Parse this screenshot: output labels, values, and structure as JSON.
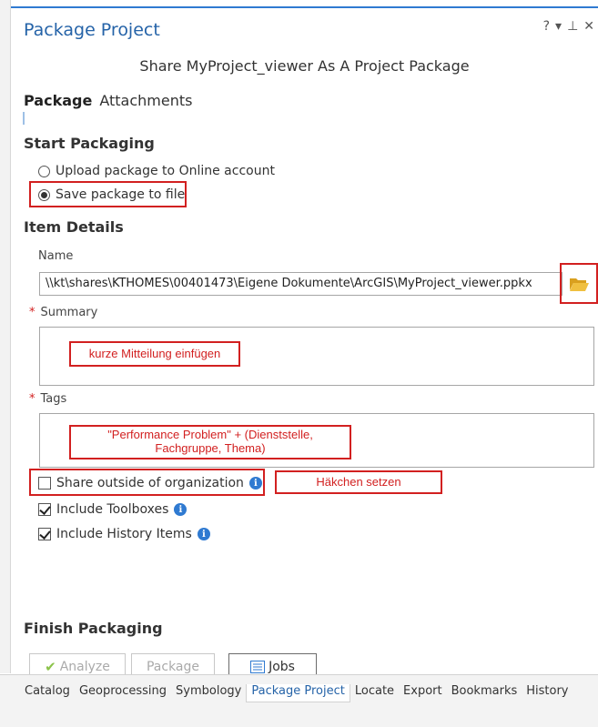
{
  "window": {
    "title": "Package Project",
    "controls": [
      "?",
      "▾",
      "⊥",
      "✕"
    ]
  },
  "subtitle": "Share MyProject_viewer As A Project Package",
  "tabs": [
    {
      "label": "Package",
      "active": true
    },
    {
      "label": "Attachments",
      "active": false
    }
  ],
  "start_packaging": {
    "heading": "Start Packaging",
    "options": [
      {
        "label": "Upload package to Online account",
        "selected": false
      },
      {
        "label": "Save package to file",
        "selected": true
      }
    ]
  },
  "item_details": {
    "heading": "Item Details",
    "name_label": "Name",
    "name_value": "\\\\kt\\shares\\KTHOMES\\00401473\\Eigene Dokumente\\ArcGIS\\MyProject_viewer.ppkx",
    "summary_label": "Summary",
    "tags_label": "Tags",
    "required_marker": "*"
  },
  "annotations": {
    "summary_note": "kurze Mitteilung einfügen",
    "tags_note_line1": "\"Performance Problem\" + (Dienststelle,",
    "tags_note_line2": "Fachgruppe, Thema)",
    "share_note": "Häkchen setzen"
  },
  "checkboxes": [
    {
      "label": "Share outside of organization",
      "checked": false
    },
    {
      "label": "Include Toolboxes",
      "checked": true
    },
    {
      "label": "Include History Items",
      "checked": true
    }
  ],
  "info_glyph": "i",
  "finish_packaging": {
    "heading": "Finish Packaging",
    "analyze_label": "Analyze",
    "package_label": "Package",
    "jobs_label": "Jobs"
  },
  "bottom_tabs": [
    {
      "label": "Catalog",
      "active": false
    },
    {
      "label": "Geoprocessing",
      "active": false
    },
    {
      "label": "Symbology",
      "active": false
    },
    {
      "label": "Package Project",
      "active": true
    },
    {
      "label": "Locate",
      "active": false
    },
    {
      "label": "Export",
      "active": false
    },
    {
      "label": "Bookmarks",
      "active": false
    },
    {
      "label": "History",
      "active": false
    }
  ],
  "colors": {
    "accent": "#2f7ad1",
    "title": "#2563a8",
    "annotation_red": "#d22020",
    "folder": "#e8b230"
  },
  "icons": {
    "browse": "folder-open-icon",
    "info": "info-icon",
    "analyze": "checkmark-icon",
    "jobs": "list-icon"
  }
}
